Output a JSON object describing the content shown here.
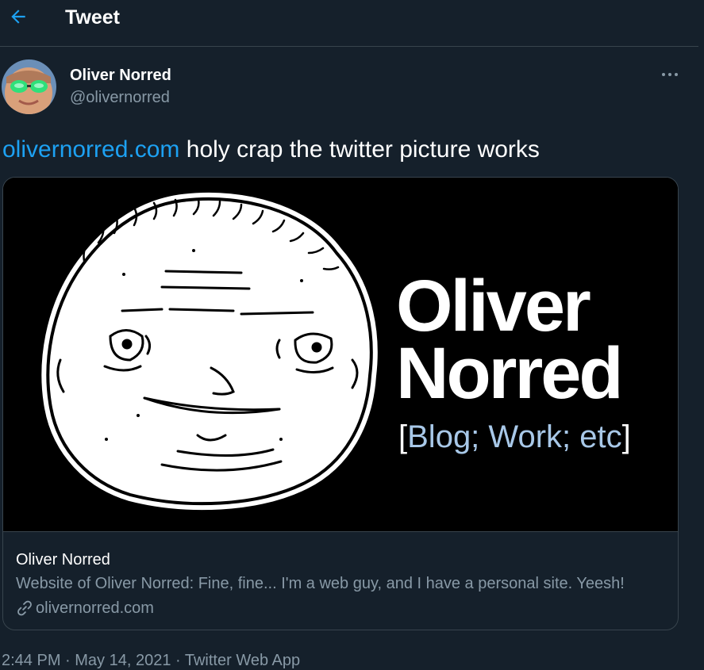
{
  "header": {
    "title": "Tweet",
    "back_icon": "arrow-left-icon",
    "accent_color": "#1da1f2"
  },
  "author": {
    "name": "Oliver Norred",
    "handle": "@olivernorred",
    "avatar_icon": "avatar"
  },
  "tweet": {
    "link_text": "olivernorred.com",
    "text": " holy crap the twitter picture works"
  },
  "card": {
    "image": {
      "title_line1": "Oliver",
      "title_line2": "Norred",
      "tagline_open": "[",
      "tagline_text": "Blog; Work; etc",
      "tagline_close": "]"
    },
    "title": "Oliver Norred",
    "description": "Website of Oliver Norred: Fine, fine... I'm a web guy, and I have a personal site. Yeesh!",
    "link": "olivernorred.com",
    "link_icon": "link-icon"
  },
  "meta": {
    "timestamp": "2:44 PM · May 14, 2021 · Twitter Web App"
  },
  "colors": {
    "background": "#15202b",
    "secondary_text": "#8899a6",
    "border": "#38444d",
    "tagline": "#a8c8e8"
  }
}
